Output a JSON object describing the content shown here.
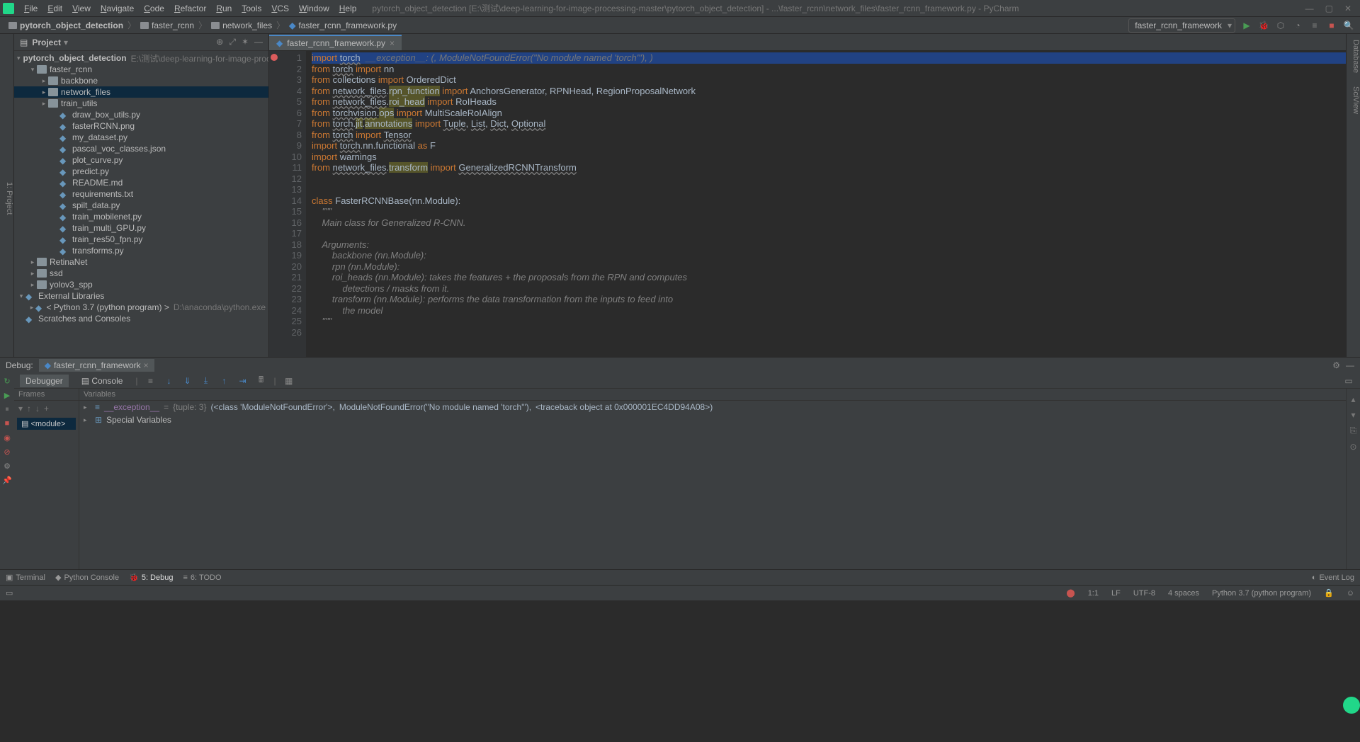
{
  "window": {
    "title": "pytorch_object_detection [E:\\测试\\deep-learning-for-image-processing-master\\pytorch_object_detection] - ...\\faster_rcnn\\network_files\\faster_rcnn_framework.py - PyCharm"
  },
  "menus": [
    "File",
    "Edit",
    "View",
    "Navigate",
    "Code",
    "Refactor",
    "Run",
    "Tools",
    "VCS",
    "Window",
    "Help"
  ],
  "breadcrumb": {
    "items": [
      "pytorch_object_detection",
      "faster_rcnn",
      "network_files",
      "faster_rcnn_framework.py"
    ]
  },
  "run_config": "faster_rcnn_framework",
  "project": {
    "title": "Project",
    "root": {
      "name": "pytorch_object_detection",
      "aux": "E:\\测试\\deep-learning-for-image-processing-m"
    },
    "tree": [
      {
        "indent": 1,
        "arrow": "▾",
        "icon": "folder",
        "label": "faster_rcnn"
      },
      {
        "indent": 2,
        "arrow": "▸",
        "icon": "folder",
        "label": "backbone"
      },
      {
        "indent": 2,
        "arrow": "▸",
        "icon": "folder",
        "label": "network_files",
        "selected": true
      },
      {
        "indent": 2,
        "arrow": "▸",
        "icon": "folder",
        "label": "train_utils"
      },
      {
        "indent": 3,
        "arrow": "",
        "icon": "py",
        "label": "draw_box_utils.py"
      },
      {
        "indent": 3,
        "arrow": "",
        "icon": "py",
        "label": "fasterRCNN.png"
      },
      {
        "indent": 3,
        "arrow": "",
        "icon": "py",
        "label": "my_dataset.py"
      },
      {
        "indent": 3,
        "arrow": "",
        "icon": "py",
        "label": "pascal_voc_classes.json"
      },
      {
        "indent": 3,
        "arrow": "",
        "icon": "py",
        "label": "plot_curve.py"
      },
      {
        "indent": 3,
        "arrow": "",
        "icon": "py",
        "label": "predict.py"
      },
      {
        "indent": 3,
        "arrow": "",
        "icon": "py",
        "label": "README.md"
      },
      {
        "indent": 3,
        "arrow": "",
        "icon": "py",
        "label": "requirements.txt"
      },
      {
        "indent": 3,
        "arrow": "",
        "icon": "py",
        "label": "spilt_data.py"
      },
      {
        "indent": 3,
        "arrow": "",
        "icon": "py",
        "label": "train_mobilenet.py"
      },
      {
        "indent": 3,
        "arrow": "",
        "icon": "py",
        "label": "train_multi_GPU.py"
      },
      {
        "indent": 3,
        "arrow": "",
        "icon": "py",
        "label": "train_res50_fpn.py"
      },
      {
        "indent": 3,
        "arrow": "",
        "icon": "py",
        "label": "transforms.py"
      },
      {
        "indent": 1,
        "arrow": "▸",
        "icon": "folder",
        "label": "RetinaNet"
      },
      {
        "indent": 1,
        "arrow": "▸",
        "icon": "folder",
        "label": "ssd"
      },
      {
        "indent": 1,
        "arrow": "▸",
        "icon": "folder",
        "label": "yolov3_spp"
      },
      {
        "indent": 0,
        "arrow": "▾",
        "icon": "lib",
        "label": "External Libraries"
      },
      {
        "indent": 1,
        "arrow": "▸",
        "icon": "py",
        "label": "< Python 3.7 (python program) >",
        "aux": "D:\\anaconda\\python.exe"
      },
      {
        "indent": 0,
        "arrow": "",
        "icon": "scratch",
        "label": "Scratches and Consoles"
      }
    ]
  },
  "editor": {
    "tab": "faster_rcnn_framework.py",
    "inline_exception": "__exception__: (<class 'ModuleNotFoundError'>, ModuleNotFoundError(\"No module named 'torch'\"), <traceback object at 0x000001EC4DD94A08>)",
    "lines": [
      {
        "n": 1,
        "bp": true,
        "current": true,
        "html": "<span class='kw'>import</span> <span class='und'>torch</span>"
      },
      {
        "n": 2,
        "html": "<span class='kw'>from</span> <span class='und'>torch</span> <span class='kw'>import</span> nn"
      },
      {
        "n": 3,
        "html": "<span class='kw'>from</span> collections <span class='kw'>import</span> OrderedDict"
      },
      {
        "n": 4,
        "html": "<span class='kw'>from</span> <span class='und'>network_files</span>.<span class='underline-y'>rpn_function</span> <span class='kw'>import</span> AnchorsGenerator, RPNHead, RegionProposalNetwork"
      },
      {
        "n": 5,
        "html": "<span class='kw'>from</span> <span class='und'>network_files</span>.<span class='underline-y'>roi_head</span> <span class='kw'>import</span> RoIHeads"
      },
      {
        "n": 6,
        "html": "<span class='kw'>from</span> <span class='und'>torchvision</span>.<span class='underline-y'>ops</span> <span class='kw'>import</span> MultiScaleRoIAlign"
      },
      {
        "n": 7,
        "html": "<span class='kw'>from</span> <span class='und'>torch</span>.<span class='underline-y'>jit</span>.<span class='underline-y'>annotations</span> <span class='kw'>import</span> <span class='und'>Tuple</span>, <span class='und'>List</span>, <span class='und'>Dict</span>, <span class='und'>Optional</span>"
      },
      {
        "n": 8,
        "html": "<span class='kw'>from</span> <span class='und'>torch</span> <span class='kw'>import</span> <span class='und'>Tensor</span>"
      },
      {
        "n": 9,
        "html": "<span class='kw'>import</span> <span class='und'>torch</span>.nn.functional <span class='kw'>as</span> F"
      },
      {
        "n": 10,
        "html": "<span class='kw'>import</span> warnings"
      },
      {
        "n": 11,
        "html": "<span class='kw'>from</span> <span class='und'>network_files</span>.<span class='underline-y'>transform</span> <span class='kw'>import</span> <span class='und'>GeneralizedRCNNTransform</span>"
      },
      {
        "n": 12,
        "html": ""
      },
      {
        "n": 13,
        "html": ""
      },
      {
        "n": 14,
        "html": "<span class='kw'>class</span> <span class='cls'>FasterRCNNBase</span>(nn.Module):"
      },
      {
        "n": 15,
        "html": "    <span class='com'>\"\"\"</span>"
      },
      {
        "n": 16,
        "html": "    <span class='com'>Main class for Generalized R-CNN.</span>"
      },
      {
        "n": 17,
        "html": ""
      },
      {
        "n": 18,
        "html": "    <span class='com'>Arguments:</span>"
      },
      {
        "n": 19,
        "html": "        <span class='com'>backbone (nn.Module):</span>"
      },
      {
        "n": 20,
        "html": "        <span class='com'>rpn (nn.Module):</span>"
      },
      {
        "n": 21,
        "html": "        <span class='com'>roi_heads (nn.Module): takes the features + the proposals from the RPN and computes</span>"
      },
      {
        "n": 22,
        "html": "            <span class='com'>detections / masks from it.</span>"
      },
      {
        "n": 23,
        "html": "        <span class='com'>transform (nn.Module): performs the data transformation from the inputs to feed into</span>"
      },
      {
        "n": 24,
        "html": "            <span class='com'>the model</span>"
      },
      {
        "n": 25,
        "html": "    <span class='com'>\"\"\"</span>"
      },
      {
        "n": 26,
        "html": ""
      }
    ]
  },
  "debug": {
    "title": "Debug:",
    "session": "faster_rcnn_framework",
    "tabs": {
      "debugger": "Debugger",
      "console": "Console"
    },
    "frames": {
      "title": "Frames",
      "item": "<module>"
    },
    "vars": {
      "title": "Variables",
      "exception": {
        "name": "__exception__",
        "type": "{tuple: 3}",
        "val1": "(<class 'ModuleNotFoundError'>,",
        "val2": "ModuleNotFoundError(\"No module named 'torch'\"),",
        "val3": "<traceback object at 0x000001EC4DD94A08>)"
      },
      "special": "Special Variables"
    }
  },
  "bottom_tabs": {
    "terminal": "Terminal",
    "pyconsole": "Python Console",
    "debug": "5: Debug",
    "todo": "6: TODO",
    "eventlog": "Event Log"
  },
  "status": {
    "pos": "1:1",
    "le": "LF",
    "enc": "UTF-8",
    "indent": "4 spaces",
    "interp": "Python 3.7 (python program)"
  },
  "side_tools": {
    "left": "1: Project",
    "right1": "Database",
    "right2": "SciView"
  }
}
